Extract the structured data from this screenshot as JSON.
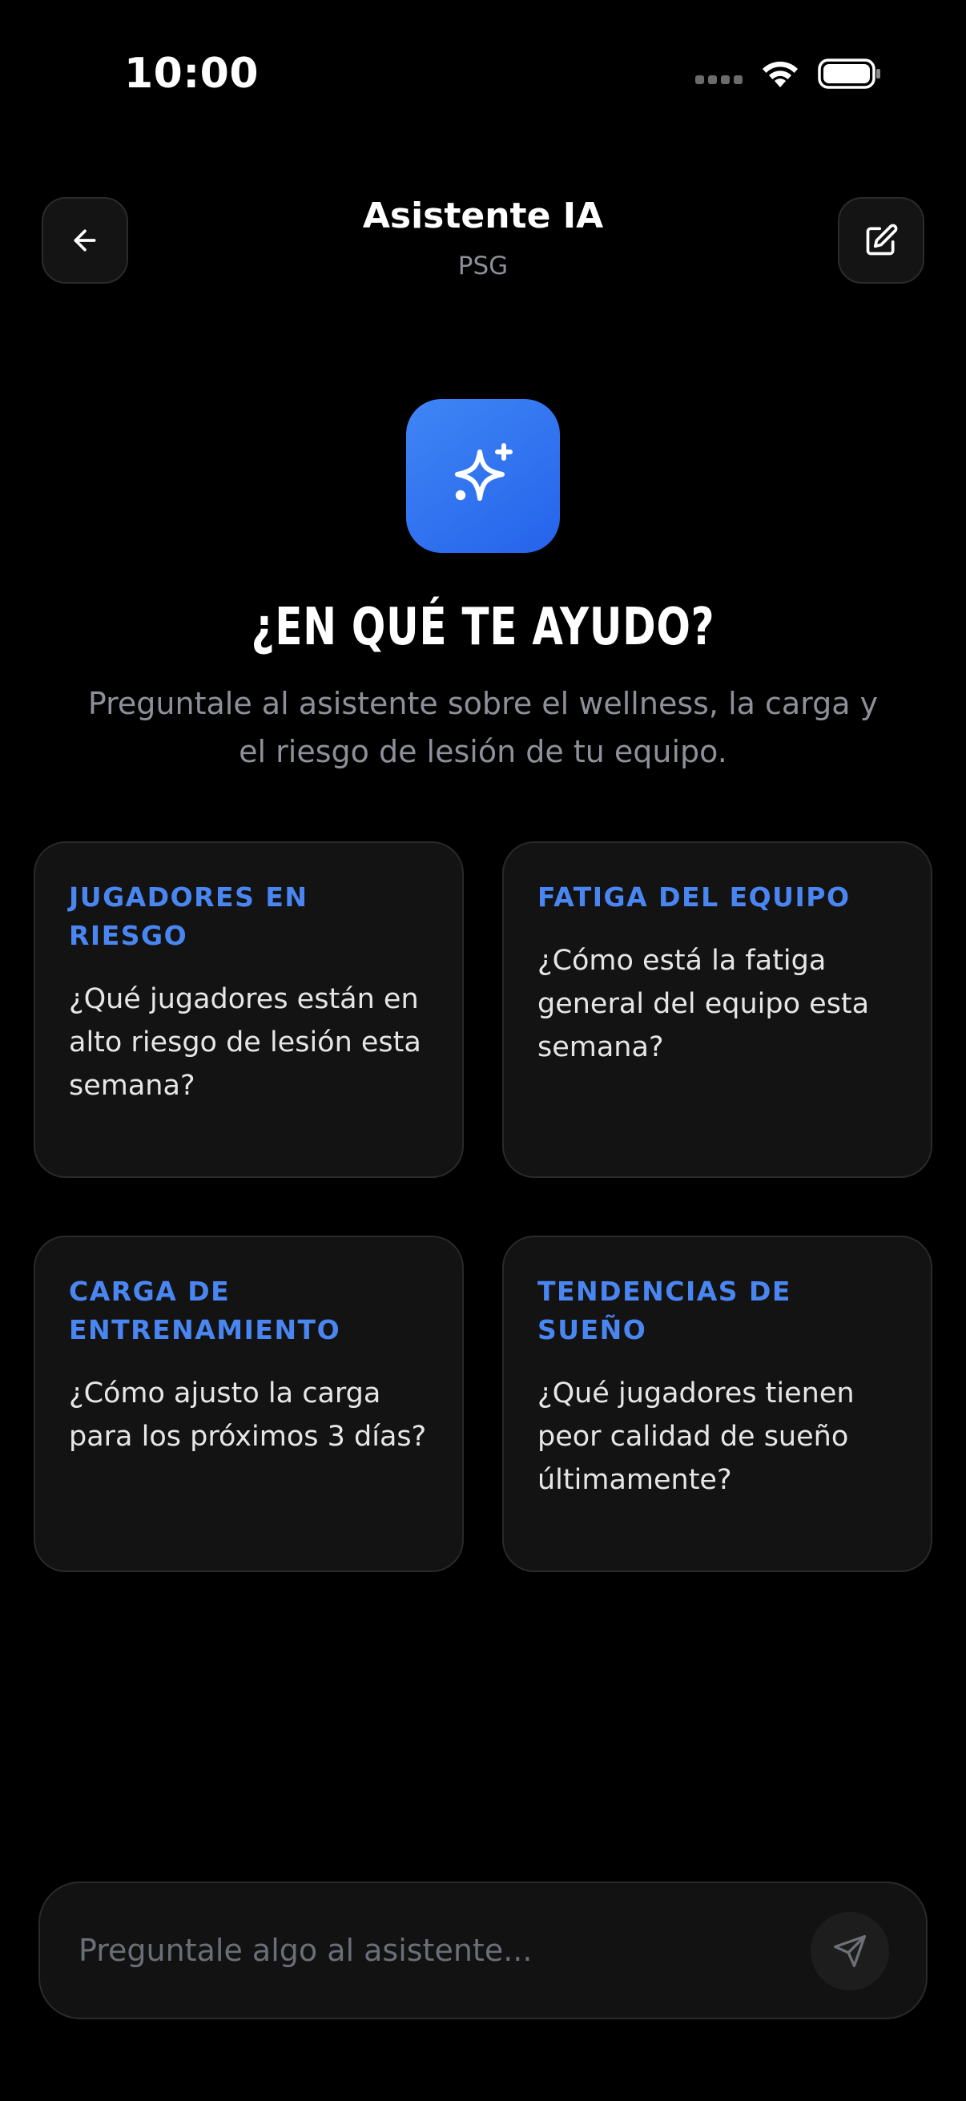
{
  "status_bar": {
    "time": "10:00"
  },
  "header": {
    "title": "Asistente IA",
    "subtitle": "PSG"
  },
  "hero": {
    "title": "¿EN QUÉ TE AYUDO?",
    "description": "Preguntale al asistente sobre el wellness, la carga y el riesgo de lesión de tu equipo."
  },
  "suggestions": [
    {
      "label": "JUGADORES EN RIESGO",
      "text": "¿Qué jugadores están en alto riesgo de lesión esta semana?"
    },
    {
      "label": "FATIGA DEL EQUIPO",
      "text": "¿Cómo está la fatiga general del equipo esta semana?"
    },
    {
      "label": "CARGA DE ENTRENAMIENTO",
      "text": "¿Cómo ajusto la carga para los próximos 3 días?"
    },
    {
      "label": "TENDENCIAS DE SUEÑO",
      "text": "¿Qué jugadores tienen peor calidad de sueño últimamente?"
    }
  ],
  "input": {
    "placeholder": "Preguntale algo al asistente...",
    "value": ""
  },
  "icons": {
    "back": "arrow-left-icon",
    "edit": "edit-icon",
    "hero": "sparkles-icon",
    "send": "send-icon"
  },
  "colors": {
    "accent": "#4a86f2",
    "hero_gradient_start": "#3f86f5",
    "hero_gradient_end": "#2563eb",
    "background": "#000000",
    "card_background": "#131313"
  }
}
